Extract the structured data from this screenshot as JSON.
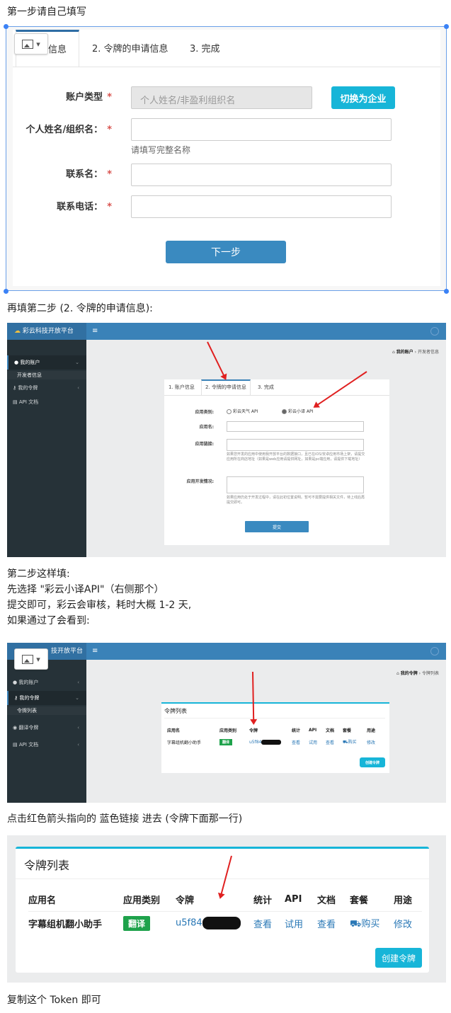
{
  "text": {
    "p1": "第一步请自己填写",
    "p2": "再填第二步 (2. 令牌的申请信息):",
    "p3_lines": [
      "第二步这样填:",
      "先选择 \"彩云小译API\"（右侧那个）",
      "提交即可，彩云会审核，耗时大概 1-2 天,",
      "如果通过了会看到:"
    ],
    "p4": "点击红色箭头指向的 蓝色链接 进去 (令牌下面那一行)",
    "p5": "复制这个 Token 即可"
  },
  "step1": {
    "tabs": [
      "1. 账户信息",
      "2. 令牌的申请信息",
      "3. 完成"
    ],
    "tab1_visible": "户信息",
    "labels": {
      "account_type": "账户类型",
      "name": "个人姓名/组织名：",
      "contact": "联系名：",
      "phone": "联系电话："
    },
    "required_mark": "*",
    "account_type_placeholder": "个人姓名/非盈利组织名",
    "switch_button": "切换为企业",
    "name_hint": "请填写完整名称",
    "next_button": "下一步"
  },
  "dash": {
    "logo": "彩云科技开放平台",
    "logo_partial": "技开放平台",
    "menu_icon": "≡",
    "sidebar1": [
      "我的账户",
      "开发者信息",
      "我的令牌",
      "API 文档"
    ],
    "sidebar2": [
      "我的账户",
      "我的令牌",
      "令牌列表",
      "翻译令牌",
      "API 文档"
    ],
    "breadcrumb1": [
      "我的账户",
      "开发者信息"
    ],
    "breadcrumb2": [
      "我的令牌",
      "令牌列表"
    ],
    "sep": "›",
    "form_tabs": [
      "1. 账户信息",
      "2. 令牌的申请信息",
      "3. 完成"
    ],
    "form_labels": [
      "应用类别:",
      "应用名:",
      "应用链接:",
      "应用开发情况:"
    ],
    "radio_options": [
      "彩云天气 API",
      "彩云小译 API"
    ],
    "help_link": "如果您开发的应用中使用我开放平台的数据接口，且已在iOS/安卓应用市场上架，请提交应用所在商店地址（如果是web应用请提供网址，如果是pc端应用，请提供下载地址）",
    "help_dev": "如果应用仍处于开发过程中，请在此初位置说明。暂可不需要提供相关文件，待上线后再提交即可。",
    "submit": "提交"
  },
  "token_table": {
    "title": "令牌列表",
    "headers": [
      "应用名",
      "应用类别",
      "令牌",
      "统计",
      "API",
      "文档",
      "套餐",
      "用途"
    ],
    "row": {
      "app_name": "字幕组机翻小助手",
      "category": "翻译",
      "token_prefix": "u5f84",
      "stats": "查看",
      "api": "试用",
      "docs": "查看",
      "plan": "购买",
      "usage": "修改"
    },
    "create_button": "创建令牌"
  },
  "colors": {
    "accent_blue": "#3a82b8",
    "sidebar_dark": "#263238",
    "cyan": "#17b5d8",
    "green_badge": "#1ea24b",
    "arrow_red": "#e02020",
    "required_red": "#d9534f"
  }
}
